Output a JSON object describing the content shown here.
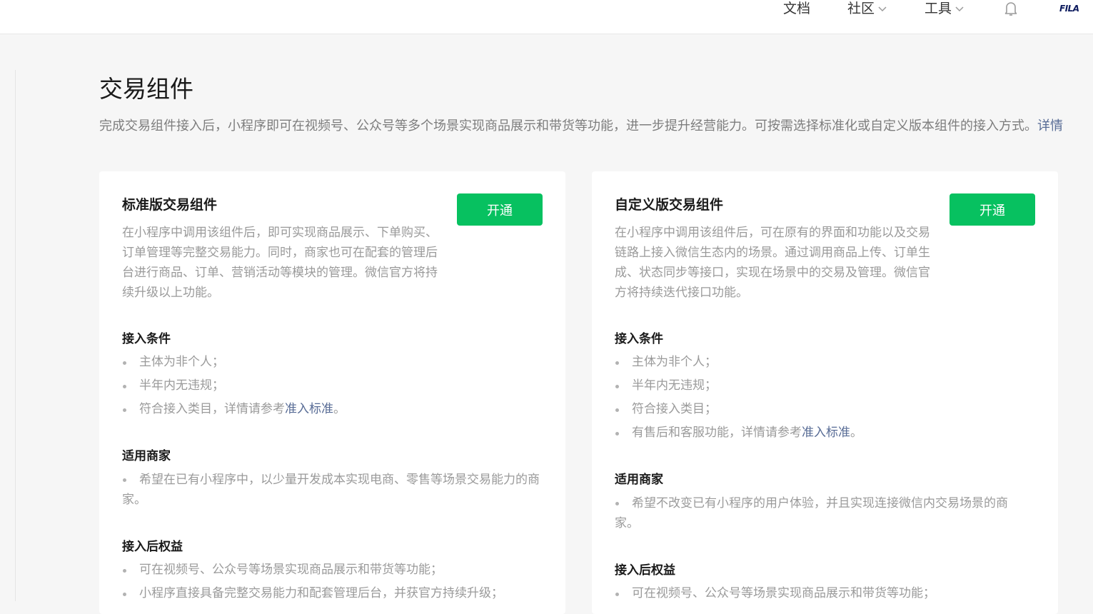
{
  "nav": {
    "docs": "文档",
    "community": "社区",
    "tools": "工具",
    "notifications_icon": "bell-icon",
    "brand": "FILA"
  },
  "page": {
    "title": "交易组件",
    "description": "完成交易组件接入后，小程序即可在视频号、公众号等多个场景实现商品展示和带货等功能，进一步提升经营能力。可按需选择标准化或自定义版本组件的接入方式。",
    "details_link": "详情"
  },
  "cards": [
    {
      "title": "标准版交易组件",
      "button": "开通",
      "description": "在小程序中调用该组件后，即可实现商品展示、下单购买、订单管理等完整交易能力。同时，商家也可在配套的管理后台进行商品、订单、营销活动等模块的管理。微信官方将持续升级以上功能。",
      "conditions_title": "接入条件",
      "conditions": [
        "主体为非个人；",
        "半年内无违规；",
        "符合接入类目，详情请参考"
      ],
      "conditions_link": "准入标准",
      "conditions_link_suffix": "。",
      "merchants_title": "适用商家",
      "merchants": [
        "希望在已有小程序中，以少量开发成本实现电商、零售等场景交易能力的商家。"
      ],
      "benefits_title": "接入后权益",
      "benefits": [
        "可在视频号、公众号等场景实现商品展示和带货等功能；",
        "小程序直接具备完整交易能力和配套管理后台，并获官方持续升级；"
      ]
    },
    {
      "title": "自定义版交易组件",
      "button": "开通",
      "description": "在小程序中调用该组件后，可在原有的界面和功能以及交易链路上接入微信生态内的场景。通过调用商品上传、订单生成、状态同步等接口，实现在场景中的交易及管理。微信官方将持续迭代接口功能。",
      "conditions_title": "接入条件",
      "conditions": [
        "主体为非个人；",
        "半年内无违规；",
        "符合接入类目；",
        "有售后和客服功能，详情请参考"
      ],
      "conditions_link": "准入标准",
      "conditions_link_suffix": "。",
      "merchants_title": "适用商家",
      "merchants": [
        "希望不改变已有小程序的用户体验，并且实现连接微信内交易场景的商家。"
      ],
      "benefits_title": "接入后权益",
      "benefits": [
        "可在视频号、公众号等场景实现商品展示和带货等功能；"
      ]
    }
  ],
  "colors": {
    "primary_green": "#07c160",
    "link": "#576b95",
    "muted_text": "#9a9a9a",
    "background": "#f6f6f6"
  }
}
